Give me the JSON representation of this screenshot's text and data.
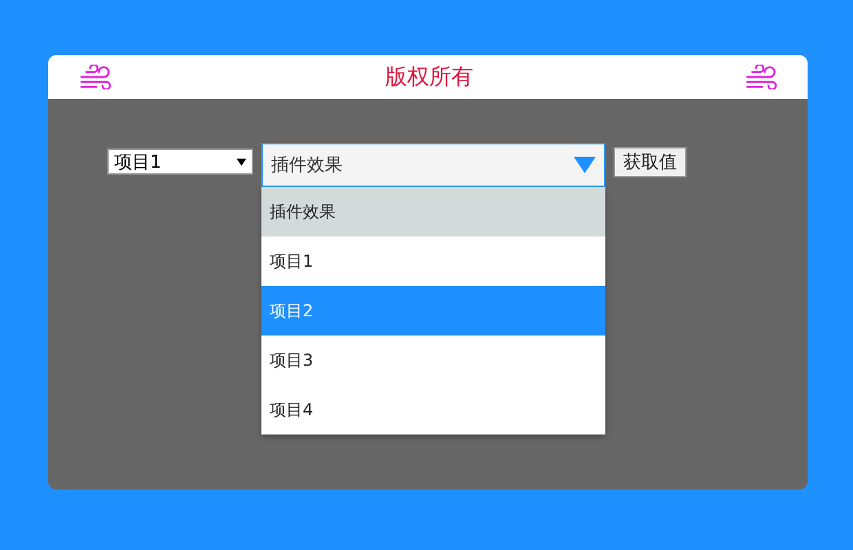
{
  "header": {
    "title": "版权所有"
  },
  "small_select": {
    "value": "项目1"
  },
  "dropdown": {
    "value": "插件效果",
    "expanded": true,
    "options": [
      {
        "label": "插件效果",
        "selected": true,
        "highlighted": false
      },
      {
        "label": "项目1",
        "selected": false,
        "highlighted": false
      },
      {
        "label": "项目2",
        "selected": false,
        "highlighted": true
      },
      {
        "label": "项目3",
        "selected": false,
        "highlighted": false
      },
      {
        "label": "项目4",
        "selected": false,
        "highlighted": false
      }
    ]
  },
  "button": {
    "label": "获取值"
  }
}
